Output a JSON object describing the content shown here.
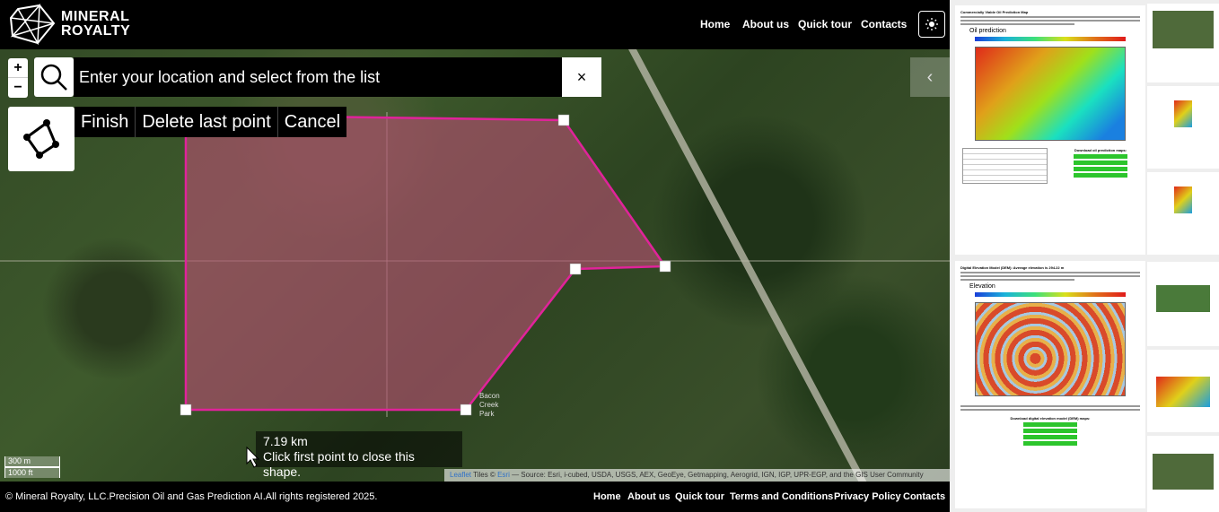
{
  "brand": {
    "line1": "MINERAL",
    "line2": "ROYALTY"
  },
  "nav": {
    "home": "Home",
    "about": "About us",
    "tour": "Quick tour",
    "contacts": "Contacts"
  },
  "search": {
    "placeholder": "Enter your location and select from the list",
    "clear": "×"
  },
  "zoom": {
    "in": "+",
    "out": "−"
  },
  "draw": {
    "finish": "Finish",
    "delete_last": "Delete last point",
    "cancel": "Cancel"
  },
  "tooltip": {
    "distance": "7.19 km",
    "hint": "Click first point to close this shape."
  },
  "scale": {
    "metric": "300 m",
    "imperial": "1000 ft"
  },
  "map_label": {
    "park": "Bacon Creek Park"
  },
  "attribution": {
    "leaflet": "Leaflet",
    "tiles": "Tiles ©",
    "esri": "Esri",
    "source": "— Source: Esri, i-cubed, USDA, USGS, AEX, GeoEye, Getmapping, Aerogrid, IGN, IGP, UPR-EGP, and the GIS User Community"
  },
  "footer": {
    "copyright": "© Mineral Royalty, LLC.Precision Oil and Gas Prediction AI.All rights registered 2025.",
    "links": [
      "Home",
      "About us",
      "Quick tour",
      "Terms and Conditions",
      "Privacy Policy",
      "Contacts"
    ]
  },
  "colors": {
    "polygon_stroke": "#e0239a",
    "polygon_fill": "#b0506e",
    "background": "#000000"
  },
  "report_preview": {
    "page1_title": "Commercially Viable Oil Prediction Map",
    "page1_heading": "Oil prediction",
    "page1_download": "Download oil prediction maps:",
    "page2_title": "Digital Elevation Model (DEM): Average elevation is 294.22 m",
    "page2_heading": "Elevation",
    "page2_download": "Download digital elevation model (DEM) maps:"
  }
}
